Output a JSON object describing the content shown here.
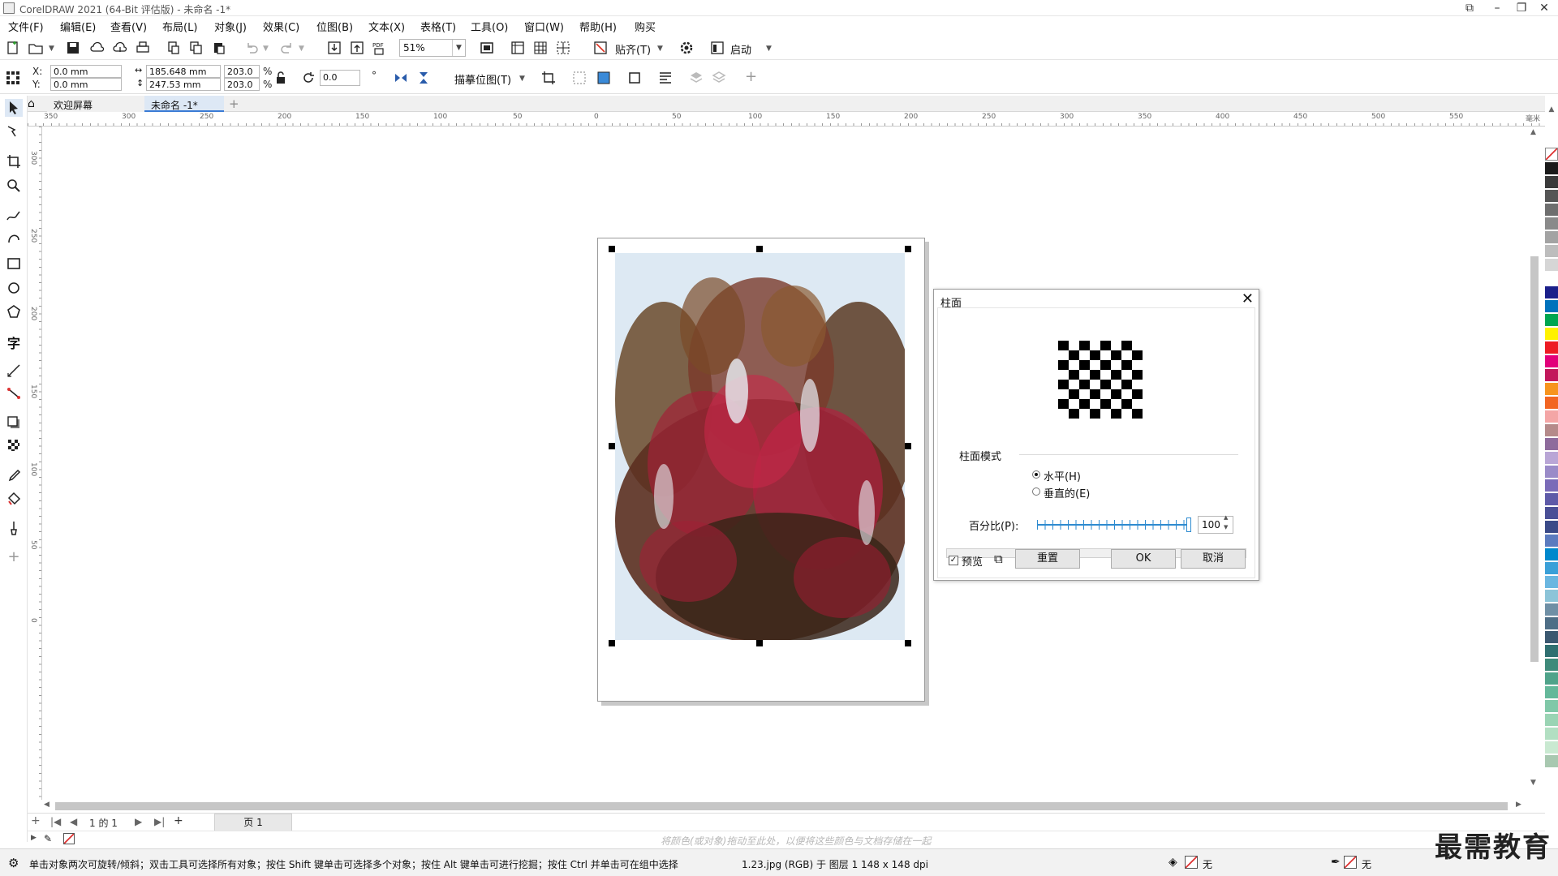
{
  "window": {
    "title": "CorelDRAW 2021 (64-Bit 评估版) - 未命名 -1*"
  },
  "menu": [
    "文件(F)",
    "编辑(E)",
    "查看(V)",
    "布局(L)",
    "对象(J)",
    "效果(C)",
    "位图(B)",
    "文本(X)",
    "表格(T)",
    "工具(O)",
    "窗口(W)",
    "帮助(H)",
    "购买"
  ],
  "toolbar": {
    "zoom": "51%",
    "snap_label": "贴齐(T)",
    "launch_label": "启动"
  },
  "propbar": {
    "x_label": "X:",
    "y_label": "Y:",
    "x": "0.0 mm",
    "y": "0.0 mm",
    "width": "185.648 mm",
    "height": "247.53 mm",
    "scale_w": "203.0",
    "scale_h": "203.0",
    "pct": "%",
    "rotation": "0.0",
    "deg": "°",
    "trace_label": "描摹位图(T)"
  },
  "doc_tabs": {
    "welcome": "欢迎屏幕",
    "doc": "未命名 -1*",
    "add": "+"
  },
  "ruler_h": [
    "350",
    "300",
    "250",
    "200",
    "150",
    "100",
    "50",
    "0",
    "50",
    "100",
    "150",
    "200",
    "250",
    "300",
    "350",
    "400",
    "450",
    "500",
    "550"
  ],
  "ruler_v": [
    "300",
    "250",
    "200",
    "150",
    "100",
    "50",
    "0"
  ],
  "ruler_unit": "毫米",
  "page_nav": {
    "add": "+",
    "first": "|◀",
    "prev": "◀",
    "count": "1  的  1",
    "next": "▶",
    "last": "▶|",
    "add2": "+",
    "page_tab": "页 1"
  },
  "color_hint": "将颜色(或对象)拖动至此处，以便将这些颜色与文档存储在一起",
  "status": {
    "hint": "单击对象两次可旋转/倾斜；双击工具可选择所有对象；按住 Shift 键单击可选择多个对象；按住 Alt 键单击可进行挖掘；按住 Ctrl 并单击可在组中选择",
    "info": "1.23.jpg (RGB) 于 图层 1 148 x 148 dpi",
    "fill": "无",
    "outline": "无"
  },
  "dialog": {
    "title": "柱面",
    "close": "✕",
    "mode_label": "柱面模式",
    "horizontal": "水平(H)",
    "vertical": "垂直的(E)",
    "percent_label": "百分比(P):",
    "percent_value": "100",
    "preview": "预览",
    "reset": "重置",
    "ok": "OK",
    "cancel": "取消"
  },
  "palette": [
    "#1a1a1a",
    "#3a3a3a",
    "#555555",
    "#6e6e6e",
    "#8a8a8a",
    "#a3a3a3",
    "#bdbdbd",
    "#d6d6d6",
    "#ffffff",
    "#1b1f8a",
    "#0072bc",
    "#00a651",
    "#fff200",
    "#ed1c24",
    "#e2007a",
    "#c2185b",
    "#f7941d",
    "#f26522",
    "#f4a6a6",
    "#b58a8a",
    "#8e6b9c",
    "#b9a6d6",
    "#9a8bc8",
    "#7a6bb8",
    "#5e5aa8",
    "#4a4f96",
    "#3a4a88",
    "#5b7bbf",
    "#0088cc",
    "#3aa0d8",
    "#6ab6e0",
    "#8cc4d8",
    "#6f8fa5",
    "#4e6e86",
    "#3b5870",
    "#2f6f70",
    "#3f8a7a",
    "#4fa38a",
    "#64b89a",
    "#80c8a8",
    "#9ad4b4",
    "#b2dfc2",
    "#c9e9d1",
    "#a8c8b0"
  ],
  "watermark": "最需教育"
}
